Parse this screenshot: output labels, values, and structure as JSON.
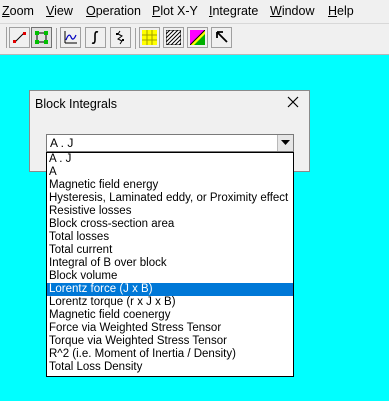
{
  "menubar": {
    "items": [
      {
        "label": "Zoom",
        "mnemonic": "Z",
        "rest": "oom"
      },
      {
        "label": "View",
        "mnemonic": "V",
        "rest": "iew"
      },
      {
        "label": "Operation",
        "mnemonic": "O",
        "rest": "peration"
      },
      {
        "label": "Plot X-Y",
        "mnemonic": "P",
        "rest": "lot X-Y"
      },
      {
        "label": "Integrate",
        "mnemonic": "I",
        "rest": "ntegrate"
      },
      {
        "label": "Window",
        "mnemonic": "W",
        "rest": "indow"
      },
      {
        "label": "Help",
        "mnemonic": "H",
        "rest": "elp"
      }
    ]
  },
  "toolbar": {
    "buttons": [
      {
        "icon": "line-icon"
      },
      {
        "icon": "select-points-icon",
        "pressed": true
      },
      {
        "icon": "plot-xy-icon"
      },
      {
        "icon": "line-integral-icon"
      },
      {
        "icon": "block-integral-icon"
      },
      {
        "icon": "grid-icon"
      },
      {
        "icon": "hatch-icon"
      },
      {
        "icon": "color-map-icon"
      },
      {
        "icon": "pointer-arrow-icon"
      }
    ]
  },
  "dialog": {
    "title": "Block Integrals",
    "close_icon": "close-icon",
    "combo": {
      "selected": "A . J"
    },
    "options": [
      "A . J",
      "A",
      "Magnetic field energy",
      "Hysteresis, Laminated eddy, or Proximity effect",
      "Resistive losses",
      "Block cross-section area",
      "Total losses",
      "Total current",
      "Integral of B over block",
      "Block volume",
      "Lorentz force (J x B)",
      "Lorentz torque (r x J x B)",
      "Magnetic field coenergy",
      "Force via Weighted Stress Tensor",
      "Torque via Weighted Stress Tensor",
      "R^2 (i.e. Moment of Inertia / Density)",
      "Total Loss Density"
    ],
    "highlighted_index": 10
  },
  "colors": {
    "workspace": "#00ffff",
    "highlight": "#0078d7",
    "chrome": "#f0f0f0"
  }
}
